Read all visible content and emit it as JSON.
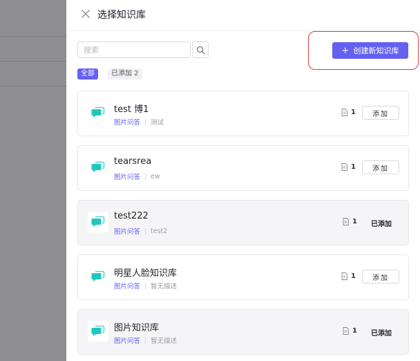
{
  "drawer": {
    "title": "选择知识库"
  },
  "search": {
    "placeholder": "搜索"
  },
  "create_button": {
    "label": "创建新知识库",
    "plus": "+"
  },
  "filters": [
    {
      "label": "全部",
      "active": true
    },
    {
      "label": "已添加 2",
      "active": false
    }
  ],
  "knowledge_bases": [
    {
      "name": "test 博1",
      "type": "图片问答",
      "desc": "测试",
      "docs": "1",
      "action": "添加",
      "added": false
    },
    {
      "name": "tearsrea",
      "type": "图片问答",
      "desc": "ew",
      "docs": "1",
      "action": "添加",
      "added": false
    },
    {
      "name": "test222",
      "type": "图片问答",
      "desc": "test2",
      "docs": "1",
      "action": "已添加",
      "added": true
    },
    {
      "name": "明星人脸知识库",
      "type": "图片问答",
      "desc": "暂无描述",
      "docs": "1",
      "action": "添加",
      "added": false
    },
    {
      "name": "图片知识库",
      "type": "图片问答",
      "desc": "暂无描述",
      "docs": "1",
      "action": "已添加",
      "added": true
    }
  ],
  "colors": {
    "accent": "#6461f0",
    "highlight": "#e23a3a",
    "icon": "#1fc8be"
  }
}
